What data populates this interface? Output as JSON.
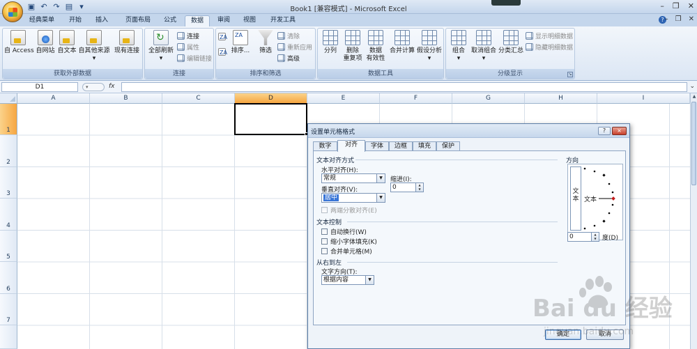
{
  "window": {
    "title": "Book1  [兼容模式] - Microsoft Excel"
  },
  "ribbon_tabs": [
    "经典菜单",
    "开始",
    "插入",
    "页面布局",
    "公式",
    "数据",
    "审阅",
    "视图",
    "开发工具"
  ],
  "active_tab": "数据",
  "ribbon": {
    "external_data": {
      "label": "获取外部数据",
      "access": "自 Access",
      "web": "自网站",
      "text": "自文本",
      "other": "自其他来源",
      "existing": "现有连接"
    },
    "connections": {
      "label": "连接",
      "refresh_all": "全部刷新",
      "connections": "连接",
      "properties": "属性",
      "edit_links": "编辑链接"
    },
    "sort_filter": {
      "label": "排序和筛选",
      "sort": "排序...",
      "filter": "筛选",
      "clear": "清除",
      "reapply": "重新应用",
      "advanced": "高级"
    },
    "data_tools": {
      "label": "数据工具",
      "text_to_cols": "分列",
      "remove_dup_1": "删除",
      "remove_dup_2": "重复项",
      "validation_1": "数据",
      "validation_2": "有效性",
      "consolidate": "合并计算",
      "whatif": "假设分析"
    },
    "outline": {
      "label": "分级显示",
      "group": "组合",
      "ungroup": "取消组合",
      "subtotal": "分类汇总",
      "show_detail": "显示明细数据",
      "hide_detail": "隐藏明细数据"
    }
  },
  "formula_bar": {
    "name_box": "D1",
    "fx": "fx"
  },
  "grid": {
    "columns": [
      "A",
      "B",
      "C",
      "D",
      "E",
      "F",
      "G",
      "H",
      "I"
    ],
    "rows": [
      "1",
      "2",
      "3",
      "4",
      "5",
      "6",
      "7"
    ],
    "selected_col": "D",
    "selected_row": "1"
  },
  "dialog": {
    "title": "设置单元格格式",
    "help": "?",
    "close": "×",
    "tabs": [
      "数字",
      "对齐",
      "字体",
      "边框",
      "填充",
      "保护"
    ],
    "active_tab": "对齐",
    "text_align_section": "文本对齐方式",
    "horizontal_label": "水平对齐(H):",
    "horizontal_value": "常规",
    "indent_label": "缩进(I):",
    "indent_value": "0",
    "vertical_label": "垂直对齐(V):",
    "vertical_value": "居中",
    "distributed_label": "两端分散对齐(E)",
    "text_control_section": "文本控制",
    "wrap_text": "自动换行(W)",
    "shrink_to_fit": "缩小字体填充(K)",
    "merge_cells": "合并单元格(M)",
    "rtl_section": "从右到左",
    "text_direction_label": "文字方向(T):",
    "text_direction_value": "根据内容",
    "orientation_section": "方向",
    "orient_vertical_text": "文本",
    "orient_text": "文本",
    "degrees_value": "0",
    "degrees_label": "度(D)",
    "ok": "确定",
    "cancel": "取消"
  },
  "watermark": {
    "text": "Bai du 经验",
    "sub": "jingyan.baidu.com"
  },
  "colors": {
    "accent": "#3875d7",
    "selected_header": "#f6a641",
    "dialog_border": "#5c7ea8"
  }
}
